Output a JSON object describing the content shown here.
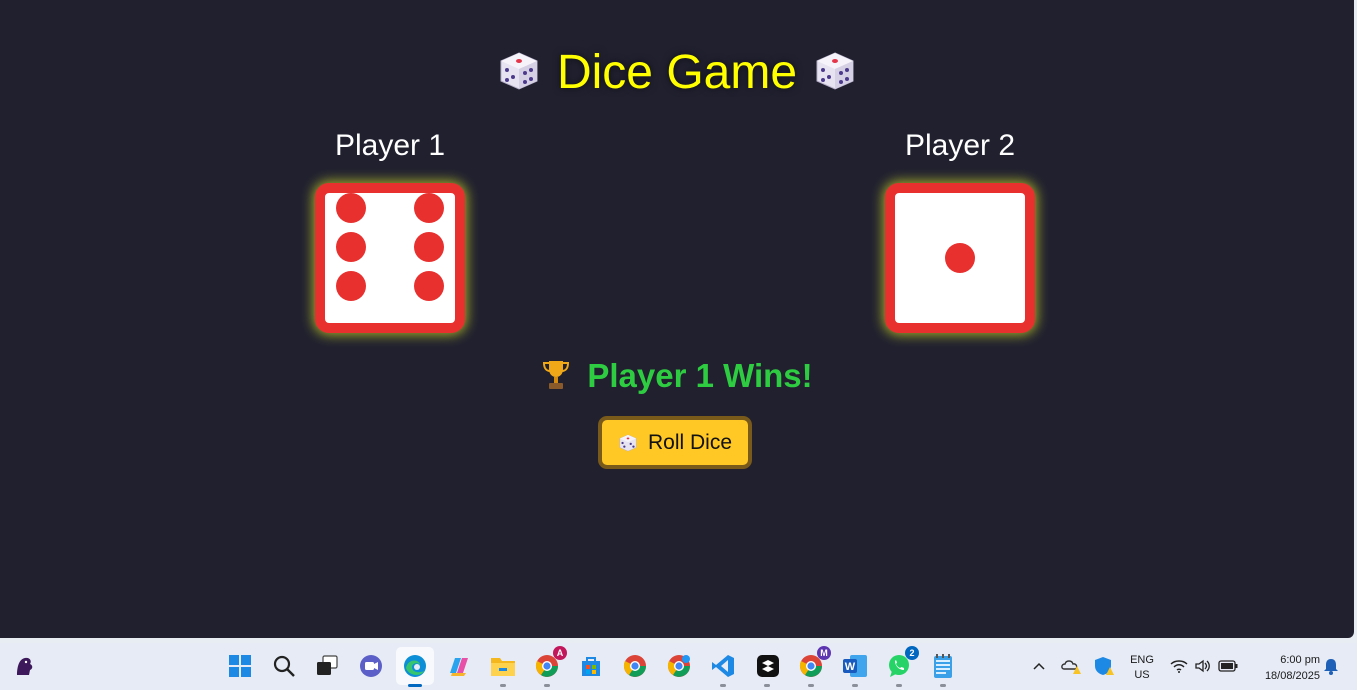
{
  "game": {
    "title": "Dice Game",
    "player1": {
      "name": "Player 1",
      "die_value": 6
    },
    "player2": {
      "name": "Player 2",
      "die_value": 1
    },
    "result": "Player 1 Wins!",
    "roll_button_label": "Roll Dice"
  },
  "colors": {
    "background": "#20202f",
    "title": "#ffff00",
    "die_border": "#e8302f",
    "pip": "#e8302f",
    "result": "#2ecc40",
    "button": "#ffc824"
  },
  "taskbar": {
    "apps": [
      "premier-league-icon",
      "start-icon",
      "search-icon",
      "task-view-icon",
      "meet-icon",
      "edge-icon",
      "copilot-icon",
      "file-explorer-icon",
      "chrome-profile-a-icon",
      "store-icon",
      "chrome-icon",
      "chrome-profile-b-icon",
      "vscode-icon",
      "capcut-icon",
      "chrome-profile-m-icon",
      "word-icon",
      "whatsapp-icon",
      "notepad-icon"
    ],
    "badges": {
      "chrome_a": "A",
      "chrome_m": "M",
      "whatsapp": "2"
    },
    "tray": {
      "language_line1": "ENG",
      "language_line2": "US",
      "time": "6:00 pm",
      "date": "18/08/2025"
    }
  }
}
